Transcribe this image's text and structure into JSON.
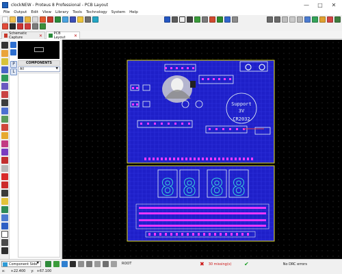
{
  "app": {
    "title": "clockNEW - Proteus 8 Professional - PCB Layout"
  },
  "window_controls": {
    "minimize": "—",
    "maximize": "□",
    "close": "✕"
  },
  "menu": [
    "File",
    "Output",
    "Edit",
    "View",
    "Library",
    "Tools",
    "Technology",
    "System",
    "Help"
  ],
  "tabs": [
    {
      "label": "Schematic Capture",
      "close": "✕"
    },
    {
      "label": "PCB Layout",
      "close": "✕"
    }
  ],
  "side_panel": {
    "header": "COMPONENTS",
    "filter": "All",
    "p_button": "P",
    "l_button": "L"
  },
  "pcb": {
    "boss_label": "Support",
    "volt_label": "3V",
    "cell_label": "CR2032",
    "digits": [
      "8",
      "8",
      "8",
      "8"
    ]
  },
  "status": {
    "layer": "Component Side",
    "root": "ROOT",
    "missing": "30 missing(s)",
    "drc": "No DRC errors"
  },
  "coords": {
    "x_label": "x:",
    "x": "+22.400",
    "y_label": "y:",
    "y": "+67.100"
  },
  "colors": {
    "board_blue": "#1e1fc8",
    "trace_blue": "#3e42f0",
    "silk": "#e8f4f4",
    "pad": "#ff38ff",
    "outline": "#e8e21a",
    "canvas": "#000000",
    "digit": "#3ad2d8"
  }
}
